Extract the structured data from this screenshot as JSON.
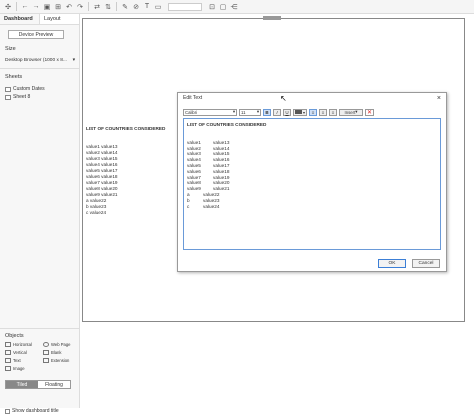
{
  "sidebar": {
    "tabs": [
      "Dashboard",
      "Layout"
    ],
    "device_preview": "Device Preview",
    "size_label": "Size",
    "size_value": "Desktop Browser (1000 x 8...",
    "sheets_label": "Sheets",
    "sheets": [
      "Custom Dates",
      "Sheet 8"
    ],
    "objects_label": "Objects",
    "objects": [
      "Horizontal",
      "Web Page",
      "Vertical",
      "Blank",
      "Text",
      "Extension",
      "Image"
    ],
    "tiled": "Tiled",
    "floating": "Floating",
    "show_title": "Show dashboard title"
  },
  "canvas": {
    "title": "LIST OF COUNTRIES CONSIDERED",
    "lines": [
      "value1 value13",
      "value2 value14",
      "value3 value15",
      "value4 value16",
      "value5 value17",
      "value6 value18",
      "value7 value19",
      "value8 value20",
      "value9 value21",
      "a value22",
      "b value23",
      "c value24"
    ]
  },
  "dialog": {
    "title": "Edit Text",
    "font": "Calibri",
    "font_size": "11",
    "bold": "B",
    "italic": "I",
    "underline": "U",
    "insert": "Insert",
    "text_title": "LIST OF COUNTRIES CONSIDERED",
    "rows": [
      {
        "a": "value1",
        "b": "value13"
      },
      {
        "a": "value2",
        "b": "value14"
      },
      {
        "a": "value3",
        "b": "value15"
      },
      {
        "a": "value4",
        "b": "value16"
      },
      {
        "a": "value5",
        "b": "value17"
      },
      {
        "a": "value6",
        "b": "value18"
      },
      {
        "a": "value7",
        "b": "value19"
      },
      {
        "a": "value8",
        "b": "value20"
      },
      {
        "a": "value9",
        "b": "value21"
      },
      {
        "a": "a",
        "b": "value22"
      },
      {
        "a": "b",
        "b": "value23"
      },
      {
        "a": "c",
        "b": "value24"
      }
    ],
    "ok": "OK",
    "cancel": "Cancel"
  },
  "icons": {
    "toolbar": [
      "tableau-logo-icon",
      "back-icon",
      "forward-icon",
      "save-icon",
      "new-datasource-icon",
      "undo-icon",
      "redo-icon",
      "swap-icon",
      "sort-icon",
      "highlight-icon",
      "group-icon",
      "label-icon",
      "fit-icon",
      "pin-icon",
      "present-icon",
      "share-icon"
    ]
  }
}
